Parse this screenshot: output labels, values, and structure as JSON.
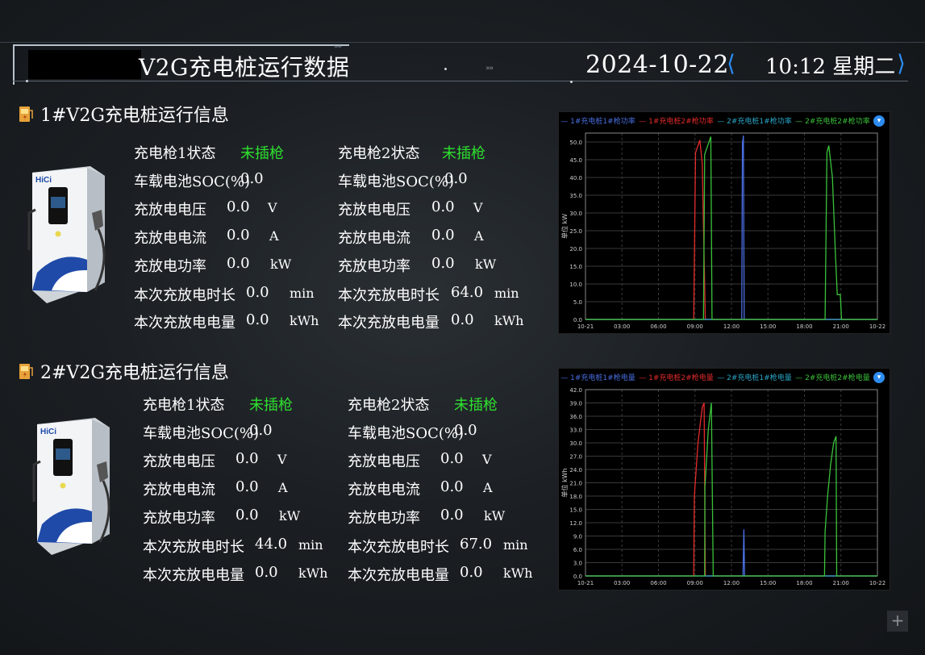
{
  "header": {
    "title": "V2G充电桩运行数据",
    "date": "2024-10-22",
    "time_weekday": "10:12 星期二"
  },
  "piles": [
    {
      "section_title": "1#V2G充电桩运行信息",
      "guns": [
        {
          "status_label": "充电枪1状态",
          "status_value": "未插枪",
          "soc_label": "车载电池SOC(%)",
          "soc_value": "0.0",
          "voltage_label": "充放电电压",
          "voltage_value": "0.0",
          "voltage_unit": "V",
          "current_label": "充放电电流",
          "current_value": "0.0",
          "current_unit": "A",
          "power_label": "充放电功率",
          "power_value": "0.0",
          "power_unit": "kW",
          "duration_label": "本次充放电时长",
          "duration_value": "0.0",
          "duration_unit": "min",
          "energy_label": "本次充放电电量",
          "energy_value": "0.0",
          "energy_unit": "kWh"
        },
        {
          "status_label": "充电枪2状态",
          "status_value": "未插枪",
          "soc_label": "车载电池SOC(%)",
          "soc_value": "0.0",
          "voltage_label": "充放电电压",
          "voltage_value": "0.0",
          "voltage_unit": "V",
          "current_label": "充放电电流",
          "current_value": "0.0",
          "current_unit": "A",
          "power_label": "充放电功率",
          "power_value": "0.0",
          "power_unit": "kW",
          "duration_label": "本次充放电时长",
          "duration_value": "64.0",
          "duration_unit": "min",
          "energy_label": "本次充放电电量",
          "energy_value": "0.0",
          "energy_unit": "kWh"
        }
      ]
    },
    {
      "section_title": "2#V2G充电桩运行信息",
      "guns": [
        {
          "status_label": "充电枪1状态",
          "status_value": "未插枪",
          "soc_label": "车载电池SOC(%)",
          "soc_value": "0.0",
          "voltage_label": "充放电电压",
          "voltage_value": "0.0",
          "voltage_unit": "V",
          "current_label": "充放电电流",
          "current_value": "0.0",
          "current_unit": "A",
          "power_label": "充放电功率",
          "power_value": "0.0",
          "power_unit": "kW",
          "duration_label": "本次充放电时长",
          "duration_value": "44.0",
          "duration_unit": "min",
          "energy_label": "本次充放电电量",
          "energy_value": "0.0",
          "energy_unit": "kWh"
        },
        {
          "status_label": "充电枪2状态",
          "status_value": "未插枪",
          "soc_label": "车载电池SOC(%)",
          "soc_value": "0.0",
          "voltage_label": "充放电电压",
          "voltage_value": "0.0",
          "voltage_unit": "V",
          "current_label": "充放电电流",
          "current_value": "0.0",
          "current_unit": "A",
          "power_label": "充放电功率",
          "power_value": "0.0",
          "power_unit": "kW",
          "duration_label": "本次充放电时长",
          "duration_value": "67.0",
          "duration_unit": "min",
          "energy_label": "本次充放电电量",
          "energy_value": "0.0",
          "energy_unit": "kWh"
        }
      ]
    }
  ],
  "charger_brand": "HiCi",
  "colors": {
    "accent": "#2d8cf0",
    "status_green": "#2ee02e",
    "series_blue": "#4a6fe3",
    "series_red": "#e52b2b",
    "series_cyan": "#2aa7c9",
    "series_green": "#3ac23a"
  },
  "chart_data": [
    {
      "type": "line",
      "ylabel": "单位 kW",
      "x_tick_labels": [
        "10-21",
        "03:00",
        "06:00",
        "09:00",
        "12:00",
        "15:00",
        "18:00",
        "21:00",
        "10-22"
      ],
      "x_hours_range": [
        0,
        24
      ],
      "ylim": [
        0,
        52.5
      ],
      "y_ticks": [
        0.0,
        5.0,
        10.0,
        15.0,
        20.0,
        25.0,
        30.0,
        35.0,
        40.0,
        45.0,
        50.0
      ],
      "y_decimals": 1,
      "grid": true,
      "legend": "top",
      "series": [
        {
          "name": "1#充电桩1#枪功率",
          "color": "#4a6fe3",
          "points": [
            [
              0,
              0
            ],
            [
              12.85,
              0
            ],
            [
              12.9,
              49.5
            ],
            [
              12.98,
              51.8
            ],
            [
              13.05,
              0
            ],
            [
              24,
              0
            ]
          ]
        },
        {
          "name": "1#充电桩2#枪功率",
          "color": "#e52b2b",
          "points": [
            [
              0,
              0
            ],
            [
              8.9,
              0
            ],
            [
              9.05,
              47
            ],
            [
              9.4,
              50.5
            ],
            [
              9.6,
              44
            ],
            [
              9.85,
              0
            ],
            [
              24,
              0
            ]
          ]
        },
        {
          "name": "2#充电桩1#枪功率",
          "color": "#2aa7c9",
          "points": [
            [
              0,
              0
            ],
            [
              24,
              0
            ]
          ]
        },
        {
          "name": "2#充电桩2#枪功率",
          "color": "#3ac23a",
          "points": [
            [
              0,
              0
            ],
            [
              9.7,
              0
            ],
            [
              9.8,
              46.5
            ],
            [
              10.3,
              51.5
            ],
            [
              10.4,
              0
            ],
            [
              19.7,
              0
            ],
            [
              19.85,
              47
            ],
            [
              20.0,
              49
            ],
            [
              20.3,
              40
            ],
            [
              20.55,
              18
            ],
            [
              20.7,
              7
            ],
            [
              20.95,
              7
            ],
            [
              21.05,
              0
            ],
            [
              24,
              0
            ]
          ]
        }
      ]
    },
    {
      "type": "line",
      "ylabel": "单位 kWh",
      "x_tick_labels": [
        "10-21",
        "03:00",
        "06:00",
        "09:00",
        "12:00",
        "15:00",
        "18:00",
        "21:00",
        "10-22"
      ],
      "x_hours_range": [
        0,
        24
      ],
      "ylim": [
        0,
        42.0
      ],
      "y_ticks": [
        0.0,
        3.0,
        6.0,
        9.0,
        12.0,
        15.0,
        18.0,
        21.0,
        24.0,
        27.0,
        30.0,
        33.0,
        36.0,
        39.0,
        42.0
      ],
      "y_decimals": 1,
      "grid": true,
      "legend": "top",
      "series": [
        {
          "name": "1#充电桩1#枪电量",
          "color": "#4a6fe3",
          "points": [
            [
              0,
              0
            ],
            [
              12.95,
              0
            ],
            [
              13.02,
              10.5
            ],
            [
              13.08,
              0
            ],
            [
              24,
              0
            ]
          ]
        },
        {
          "name": "1#充电桩2#枪电量",
          "color": "#e52b2b",
          "points": [
            [
              0,
              0
            ],
            [
              8.9,
              0
            ],
            [
              8.95,
              18
            ],
            [
              9.25,
              30
            ],
            [
              9.6,
              38
            ],
            [
              9.75,
              39
            ],
            [
              9.85,
              0
            ],
            [
              24,
              0
            ]
          ]
        },
        {
          "name": "2#充电桩1#枪电量",
          "color": "#2aa7c9",
          "points": [
            [
              0,
              0
            ],
            [
              24,
              0
            ]
          ]
        },
        {
          "name": "2#充电桩2#枪电量",
          "color": "#3ac23a",
          "points": [
            [
              0,
              0
            ],
            [
              9.8,
              0
            ],
            [
              9.82,
              20
            ],
            [
              10.1,
              33
            ],
            [
              10.35,
              39
            ],
            [
              10.5,
              0
            ],
            [
              19.65,
              0
            ],
            [
              19.7,
              10
            ],
            [
              19.9,
              18
            ],
            [
              20.15,
              25
            ],
            [
              20.4,
              30
            ],
            [
              20.6,
              31.5
            ],
            [
              20.65,
              0
            ],
            [
              24,
              0
            ]
          ]
        }
      ]
    }
  ]
}
